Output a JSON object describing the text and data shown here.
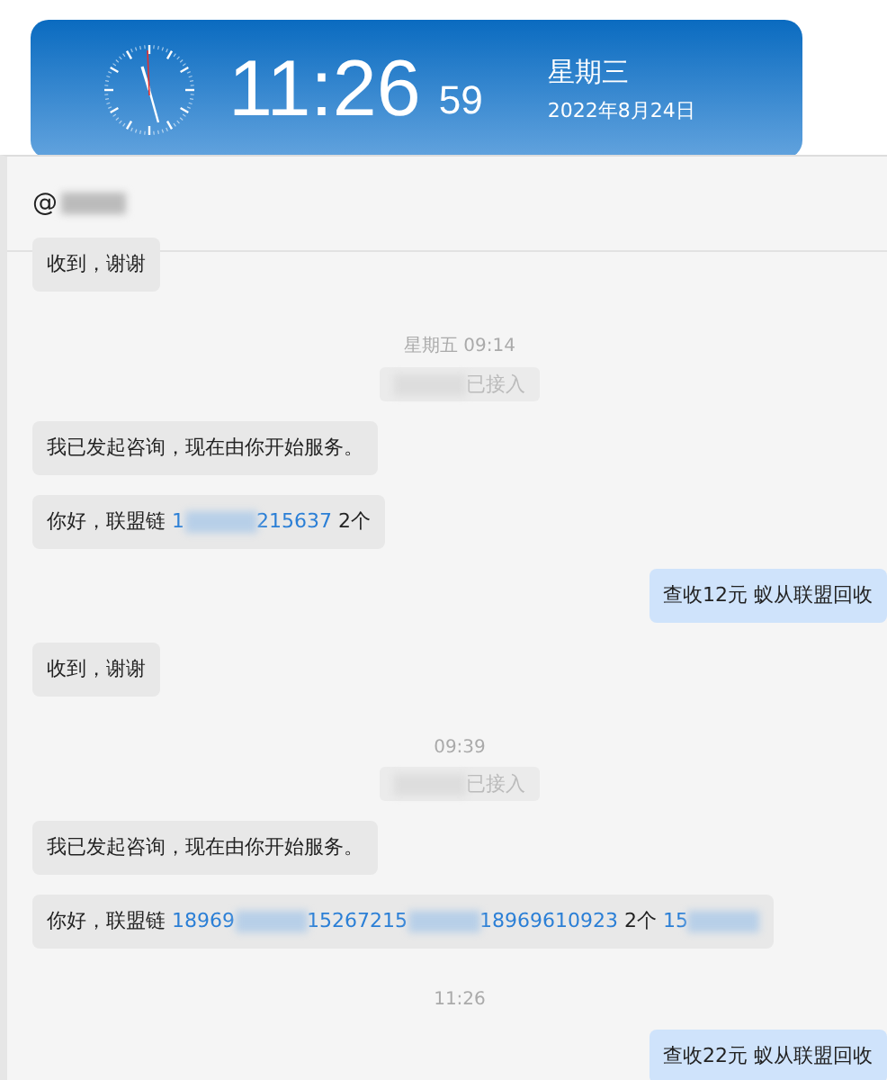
{
  "clock": {
    "time": "11:26",
    "seconds": "59",
    "weekday": "星期三",
    "date": "2022年8月24日"
  },
  "chat": {
    "title": "@",
    "messages": [
      {
        "kind": "incoming",
        "parts": [
          {
            "kind": "text",
            "text": "收到，谢谢"
          }
        ]
      },
      {
        "kind": "time",
        "text": "星期五 09:14"
      },
      {
        "kind": "system",
        "parts": [
          {
            "kind": "redacted"
          },
          {
            "kind": "text",
            "text": "已接入"
          }
        ]
      },
      {
        "kind": "incoming",
        "parts": [
          {
            "kind": "text",
            "text": "我已发起咨询，现在由你开始服务。"
          }
        ]
      },
      {
        "kind": "incoming",
        "parts": [
          {
            "kind": "text",
            "text": "你好，联盟链 "
          },
          {
            "kind": "link",
            "text": "1"
          },
          {
            "kind": "redacted"
          },
          {
            "kind": "link",
            "text": "215637"
          },
          {
            "kind": "text",
            "text": " 2个"
          }
        ]
      },
      {
        "kind": "outgoing",
        "parts": [
          {
            "kind": "text",
            "text": "查收12元 蚁从联盟回收"
          }
        ]
      },
      {
        "kind": "incoming",
        "parts": [
          {
            "kind": "text",
            "text": "收到，谢谢"
          }
        ]
      },
      {
        "kind": "time",
        "text": "09:39"
      },
      {
        "kind": "system",
        "parts": [
          {
            "kind": "redacted"
          },
          {
            "kind": "text",
            "text": "已接入"
          }
        ]
      },
      {
        "kind": "incoming",
        "parts": [
          {
            "kind": "text",
            "text": "我已发起咨询，现在由你开始服务。"
          }
        ]
      },
      {
        "kind": "incoming",
        "parts": [
          {
            "kind": "text",
            "text": "你好，联盟链 "
          },
          {
            "kind": "link",
            "text": "18969"
          },
          {
            "kind": "redacted"
          },
          {
            "kind": "link",
            "text": "15267215"
          },
          {
            "kind": "redacted"
          },
          {
            "kind": "link",
            "text": "18969610923"
          },
          {
            "kind": "text",
            "text": " 2个 "
          },
          {
            "kind": "link",
            "text": "15"
          },
          {
            "kind": "redacted"
          }
        ]
      },
      {
        "kind": "time",
        "text": "11:26"
      },
      {
        "kind": "outgoing",
        "parts": [
          {
            "kind": "text",
            "text": "查收22元 蚁从联盟回收"
          }
        ]
      }
    ]
  }
}
